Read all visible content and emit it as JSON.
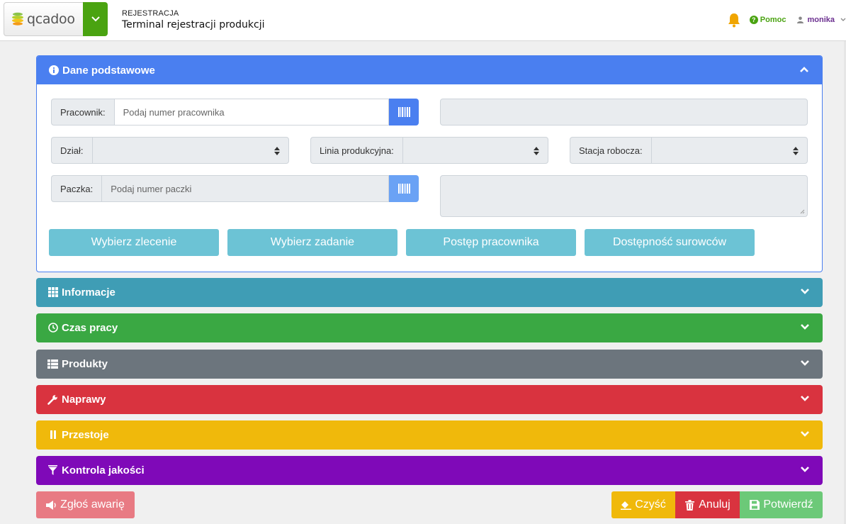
{
  "header": {
    "logo_text": "qcadoo",
    "section": "REJESTRACJA",
    "title": "Terminal rejestracji produkcji",
    "help_label": "Pomoc",
    "user_name": "monika"
  },
  "basic_panel": {
    "title": "Dane podstawowe",
    "worker_label": "Pracownik:",
    "worker_placeholder": "Podaj numer pracownika",
    "division_label": "Dział:",
    "line_label": "Linia produkcyjna:",
    "station_label": "Stacja robocza:",
    "package_label": "Paczka:",
    "package_placeholder": "Podaj numer paczki",
    "buttons": {
      "select_order": "Wybierz zlecenie",
      "select_task": "Wybierz zadanie",
      "worker_progress": "Postęp pracownika",
      "materials_availability": "Dostępność surowców"
    }
  },
  "sections": {
    "info": "Informacje",
    "work_time": "Czas pracy",
    "products": "Produkty",
    "repairs": "Naprawy",
    "downtimes": "Przestoje",
    "quality": "Kontrola jakości"
  },
  "footer": {
    "report_failure": "Zgłoś awarię",
    "clear": "Czyść",
    "cancel": "Anuluj",
    "confirm": "Potwierdź"
  },
  "colors": {
    "primary": "#4a7ff0",
    "info": "#3f9db5",
    "success": "#3aa843",
    "secondary": "#6c757d",
    "danger": "#d9333f",
    "warning": "#f0b90b",
    "purple": "#7f09b8",
    "brand_green": "#4aa311"
  }
}
